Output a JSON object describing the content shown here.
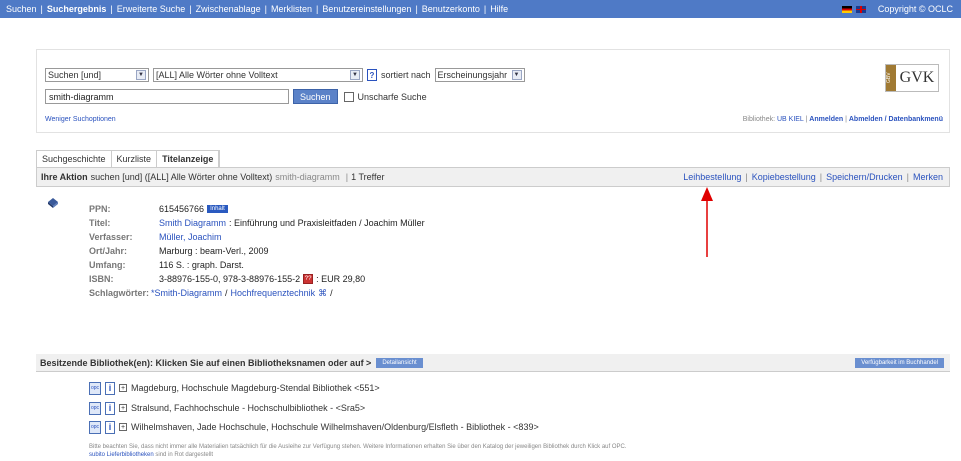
{
  "topnav": {
    "items": [
      {
        "label": "Suchen",
        "active": false
      },
      {
        "label": "Suchergebnis",
        "active": true
      },
      {
        "label": "Erweiterte Suche",
        "active": false
      },
      {
        "label": "Zwischenablage",
        "active": false
      },
      {
        "label": "Merklisten",
        "active": false
      },
      {
        "label": "Benutzereinstellungen",
        "active": false
      },
      {
        "label": "Benutzerkonto",
        "active": false
      },
      {
        "label": "Hilfe",
        "active": false
      }
    ],
    "copyright": "Copyright © OCLC"
  },
  "search": {
    "mode_select": "Suchen [und]",
    "field_select": "[ALL] Alle Wörter ohne Volltext",
    "help_icon": "?",
    "sort_label": "sortiert nach",
    "sort_select": "Erscheinungsjahr",
    "query_value": "smith-diagramm",
    "search_button": "Suchen",
    "fuzzy_label": "Unscharfe Suche",
    "less_options": "Weniger Suchoptionen"
  },
  "logo": {
    "text": "GVK",
    "strip": "GBV"
  },
  "library": {
    "label": "Bibliothek:",
    "name": "UB KIEL",
    "login": "Anmelden",
    "logout": "Abmelden / Datenbankmenü"
  },
  "tabs": [
    "Suchgeschichte",
    "Kurzliste",
    "Titelanzeige"
  ],
  "action": {
    "label": "Ihre Aktion",
    "query": "suchen [und] ([ALL] Alle Wörter ohne Volltext)",
    "term": "smith-diagramm",
    "hits": "1 Treffer",
    "links": [
      "Leihbestellung",
      "Kopiebestellung",
      "Speichern/Drucken",
      "Merken"
    ]
  },
  "record": {
    "ppn_label": "PPN:",
    "ppn": "615456766",
    "ppn_badge": "Inhalt",
    "title_label": "Titel:",
    "title_link": "Smith Diagramm",
    "title_rest": ": Einführung und Praxisleitfaden / Joachim Müller",
    "author_label": "Verfasser:",
    "author": "Müller, Joachim",
    "place_label": "Ort/Jahr:",
    "place": "Marburg : beam-Verl., 2009",
    "extent_label": "Umfang:",
    "extent": "116 S. : graph. Darst.",
    "isbn_label": "ISBN:",
    "isbn": "3-88976-155-0, 978-3-88976-155-2",
    "price": ": EUR 29,80",
    "subject_label": "Schlagwörter:",
    "subject1": "*Smith-Diagramm",
    "subject_sep": "/",
    "subject2": "Hochfrequenztechnik",
    "subject_end": "/"
  },
  "holdings": {
    "heading": "Besitzende Bibliothek(en): Klicken Sie auf einen Bibliotheksnamen oder auf >",
    "detail_button": "Detailansicht",
    "availability_button": "Verfügbarkeit im Buchhandel",
    "items": [
      "Magdeburg, Hochschule Magdeburg-Stendal Bibliothek <551>",
      "Stralsund, Fachhochschule - Hochschulbibliothek - <Sra5>",
      "Wilhelmshaven, Jade Hochschule, Hochschule Wilhelmshaven/Oldenburg/Elsfleth - Bibliothek - <839>"
    ],
    "note": "Bitte beachten Sie, dass nicht immer alle Materialien tatsächlich für die Ausleihe zur Verfügung stehen. Weitere Informationen erhalten Sie über den Katalog der jeweiligen Bibliothek durch Klick auf OPC.",
    "note_link": "subito Lieferbibliotheken",
    "note_rest": "sind in Rot dargestellt"
  },
  "colors": {
    "topbar": "#4f7ac6",
    "link": "#2a52be",
    "arrow": "#e00000"
  }
}
